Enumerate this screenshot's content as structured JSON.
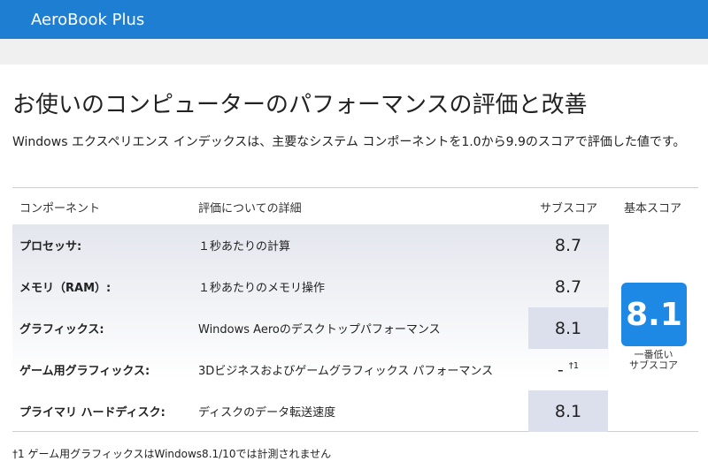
{
  "app": {
    "title": "AeroBook Plus"
  },
  "page": {
    "heading": "お使いのコンピューターのパフォーマンスの評価と改善",
    "description": "Windows エクスペリエンス インデックスは、主要なシステム コンポーネントを1.0から9.9のスコアで評価した値です。"
  },
  "table": {
    "headers": {
      "component": "コンポーネント",
      "details": "評価についての詳細",
      "subscore": "サブスコア",
      "basescore": "基本スコア"
    },
    "rows": [
      {
        "component": "プロセッサ:",
        "details": "１秒あたりの計算",
        "subscore": "8.7",
        "highlight": false
      },
      {
        "component": "メモリ（RAM）:",
        "details": "１秒あたりのメモリ操作",
        "subscore": "8.7",
        "highlight": false
      },
      {
        "component": "グラフィックス:",
        "details": "Windows Aeroのデスクトップパフォーマンス",
        "subscore": "8.1",
        "highlight": true
      },
      {
        "component": "ゲーム用グラフィックス:",
        "details": "3Dビジネスおよびゲームグラフィックス パフォーマンス",
        "subscore": "-",
        "sup": "†1",
        "highlight": false
      },
      {
        "component": "プライマリ ハードディスク:",
        "details": "ディスクのデータ転送速度",
        "subscore": "8.1",
        "highlight": true
      }
    ],
    "base": {
      "score": "8.1",
      "label_line1": "一番低い",
      "label_line2": "サブスコア"
    }
  },
  "footnote": "†1 ゲーム用グラフィックスはWindows8.1/10では計測されません",
  "colors": {
    "topbar": "#1e7fd2",
    "score_box": "#1e88e5",
    "highlight_cell": "#dcdfec"
  }
}
